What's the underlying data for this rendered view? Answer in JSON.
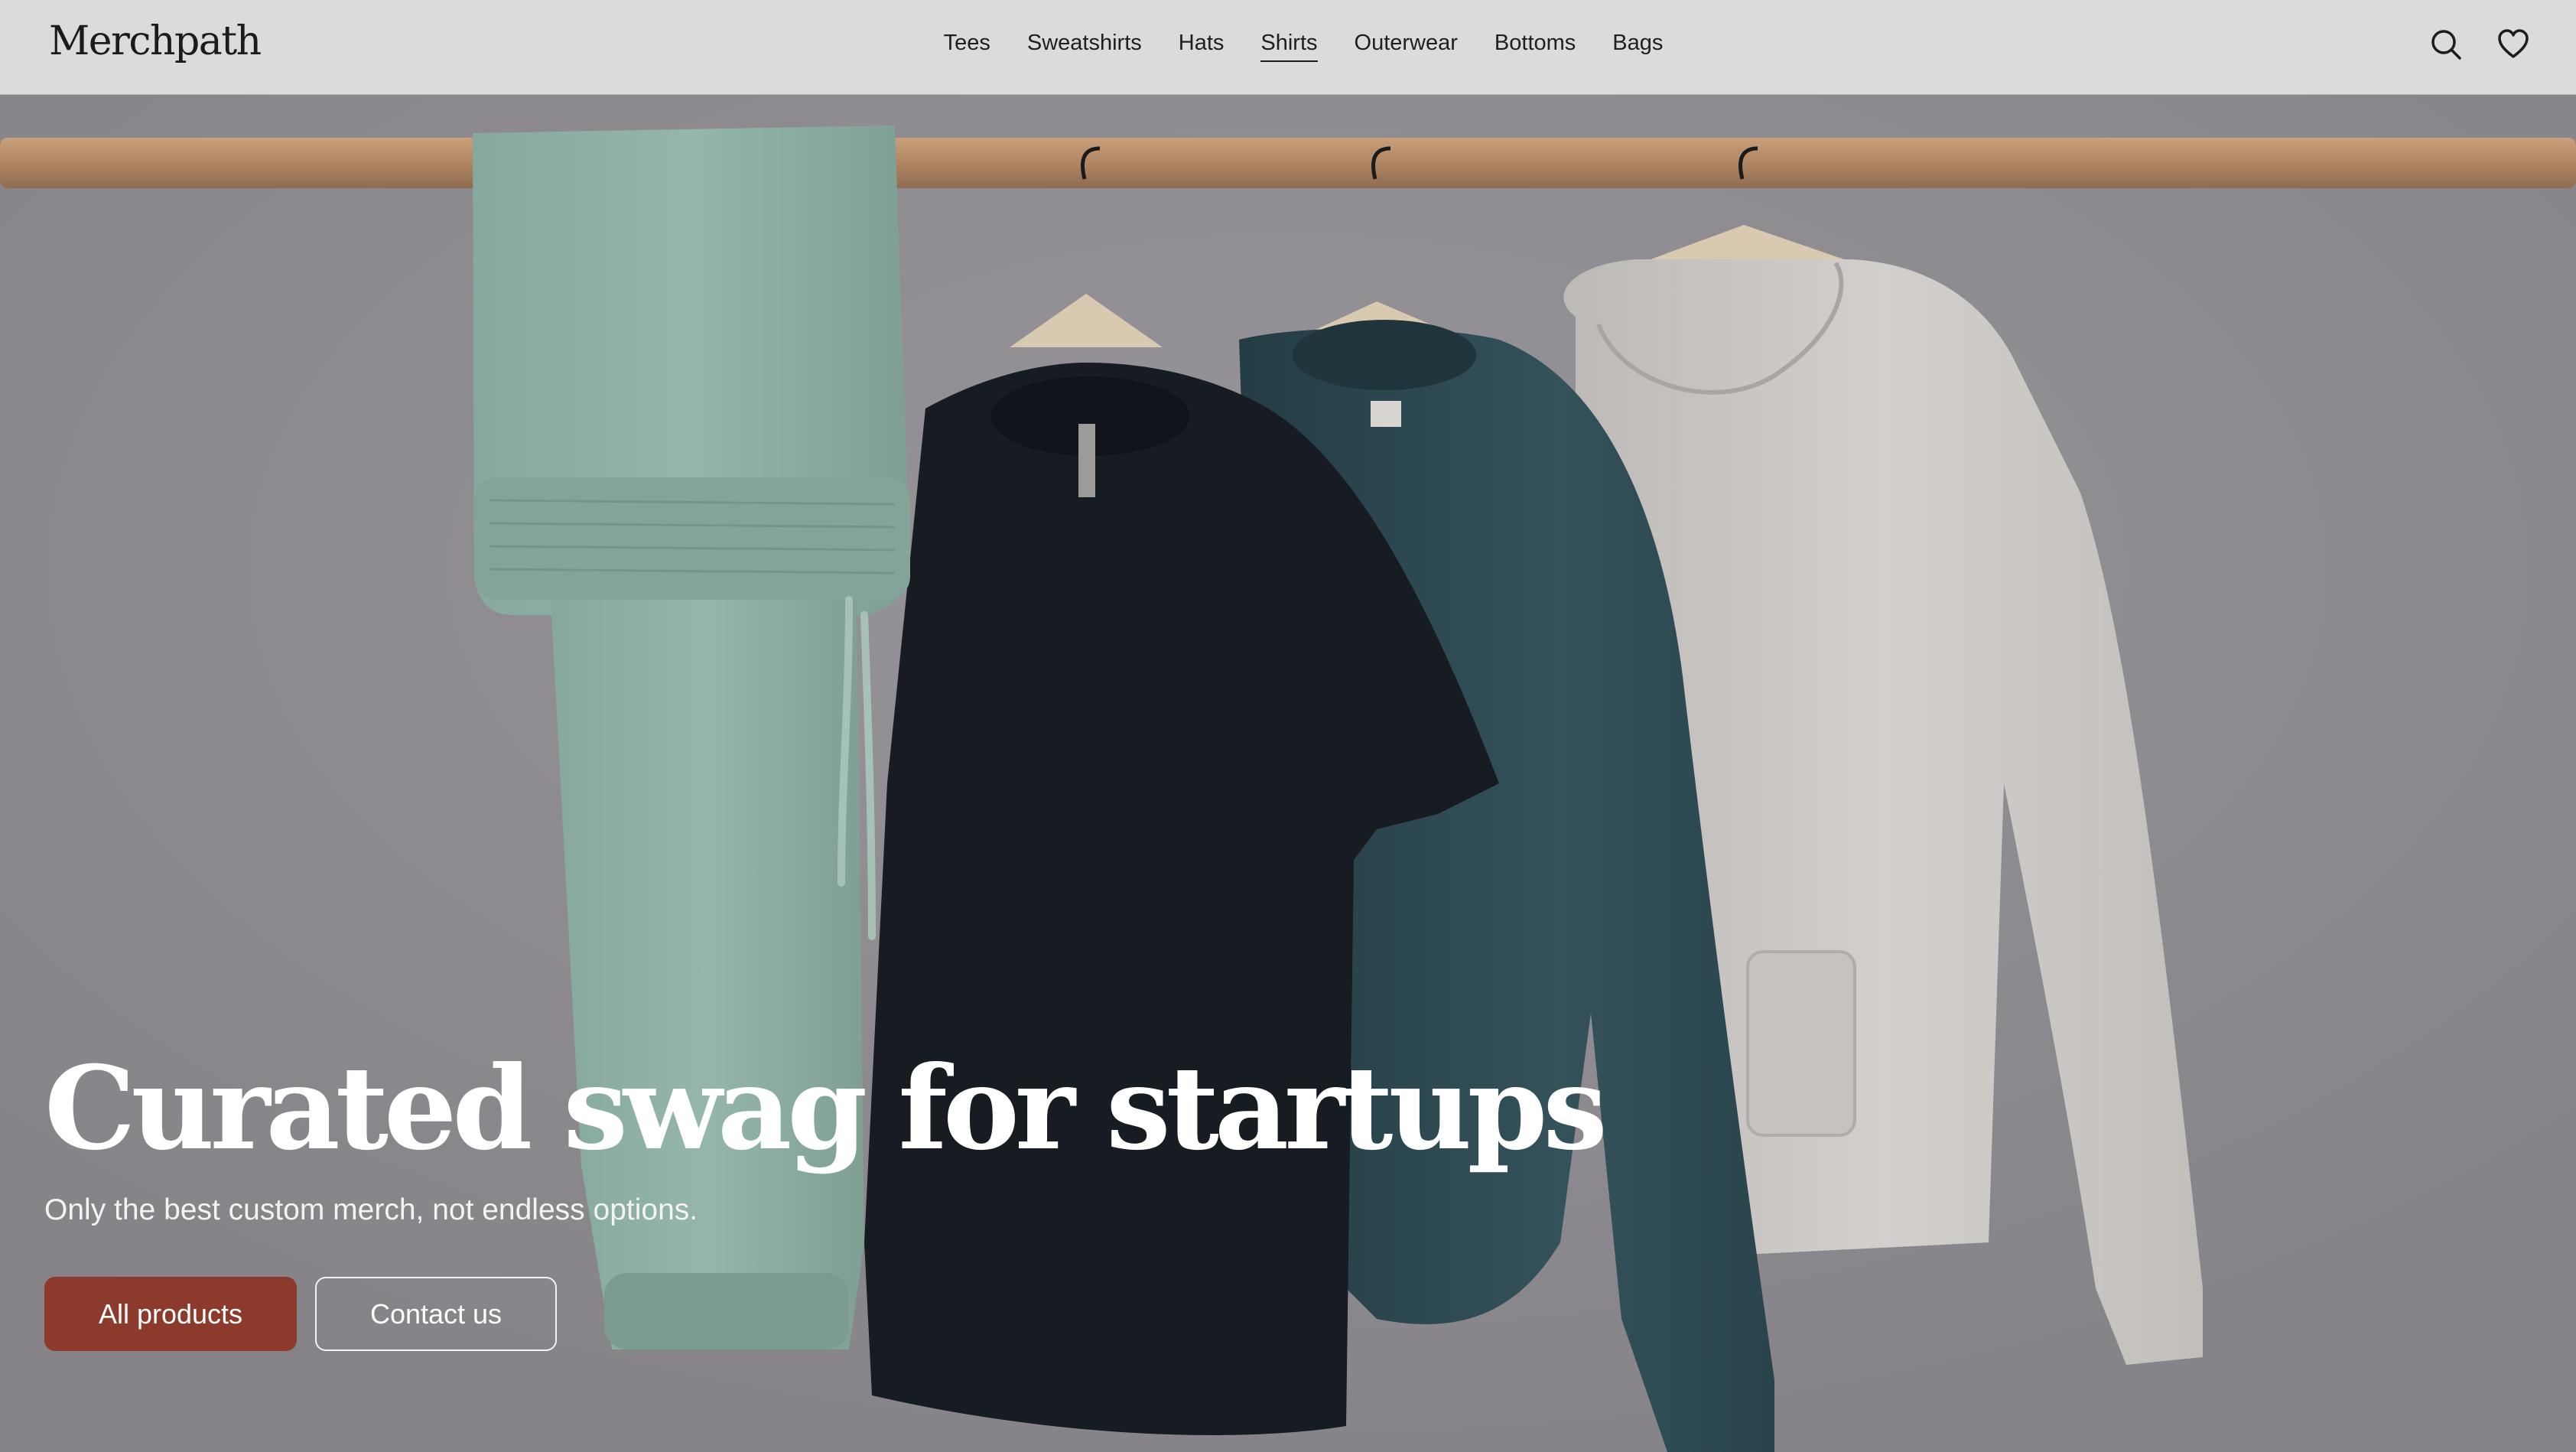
{
  "header": {
    "logo": "Merchpath",
    "nav": [
      {
        "label": "Tees"
      },
      {
        "label": "Sweatshirts"
      },
      {
        "label": "Hats"
      },
      {
        "label": "Shirts",
        "active": true
      },
      {
        "label": "Outerwear"
      },
      {
        "label": "Bottoms"
      },
      {
        "label": "Bags"
      }
    ],
    "icons": [
      "search-icon",
      "heart-icon"
    ]
  },
  "hero": {
    "title": "Curated swag for startups",
    "subtitle": "Only the best custom merch, not endless options.",
    "primary_button": "All products",
    "secondary_button": "Contact us"
  },
  "colors": {
    "accent": "#8c3a2c",
    "header_bg": "#dcdbd9",
    "rod": "#b8906a",
    "pants": "#8fb0a6",
    "tee": "#1a1e26",
    "sweatshirt": "#2f4a52",
    "hoodie": "#cfcbc8"
  }
}
